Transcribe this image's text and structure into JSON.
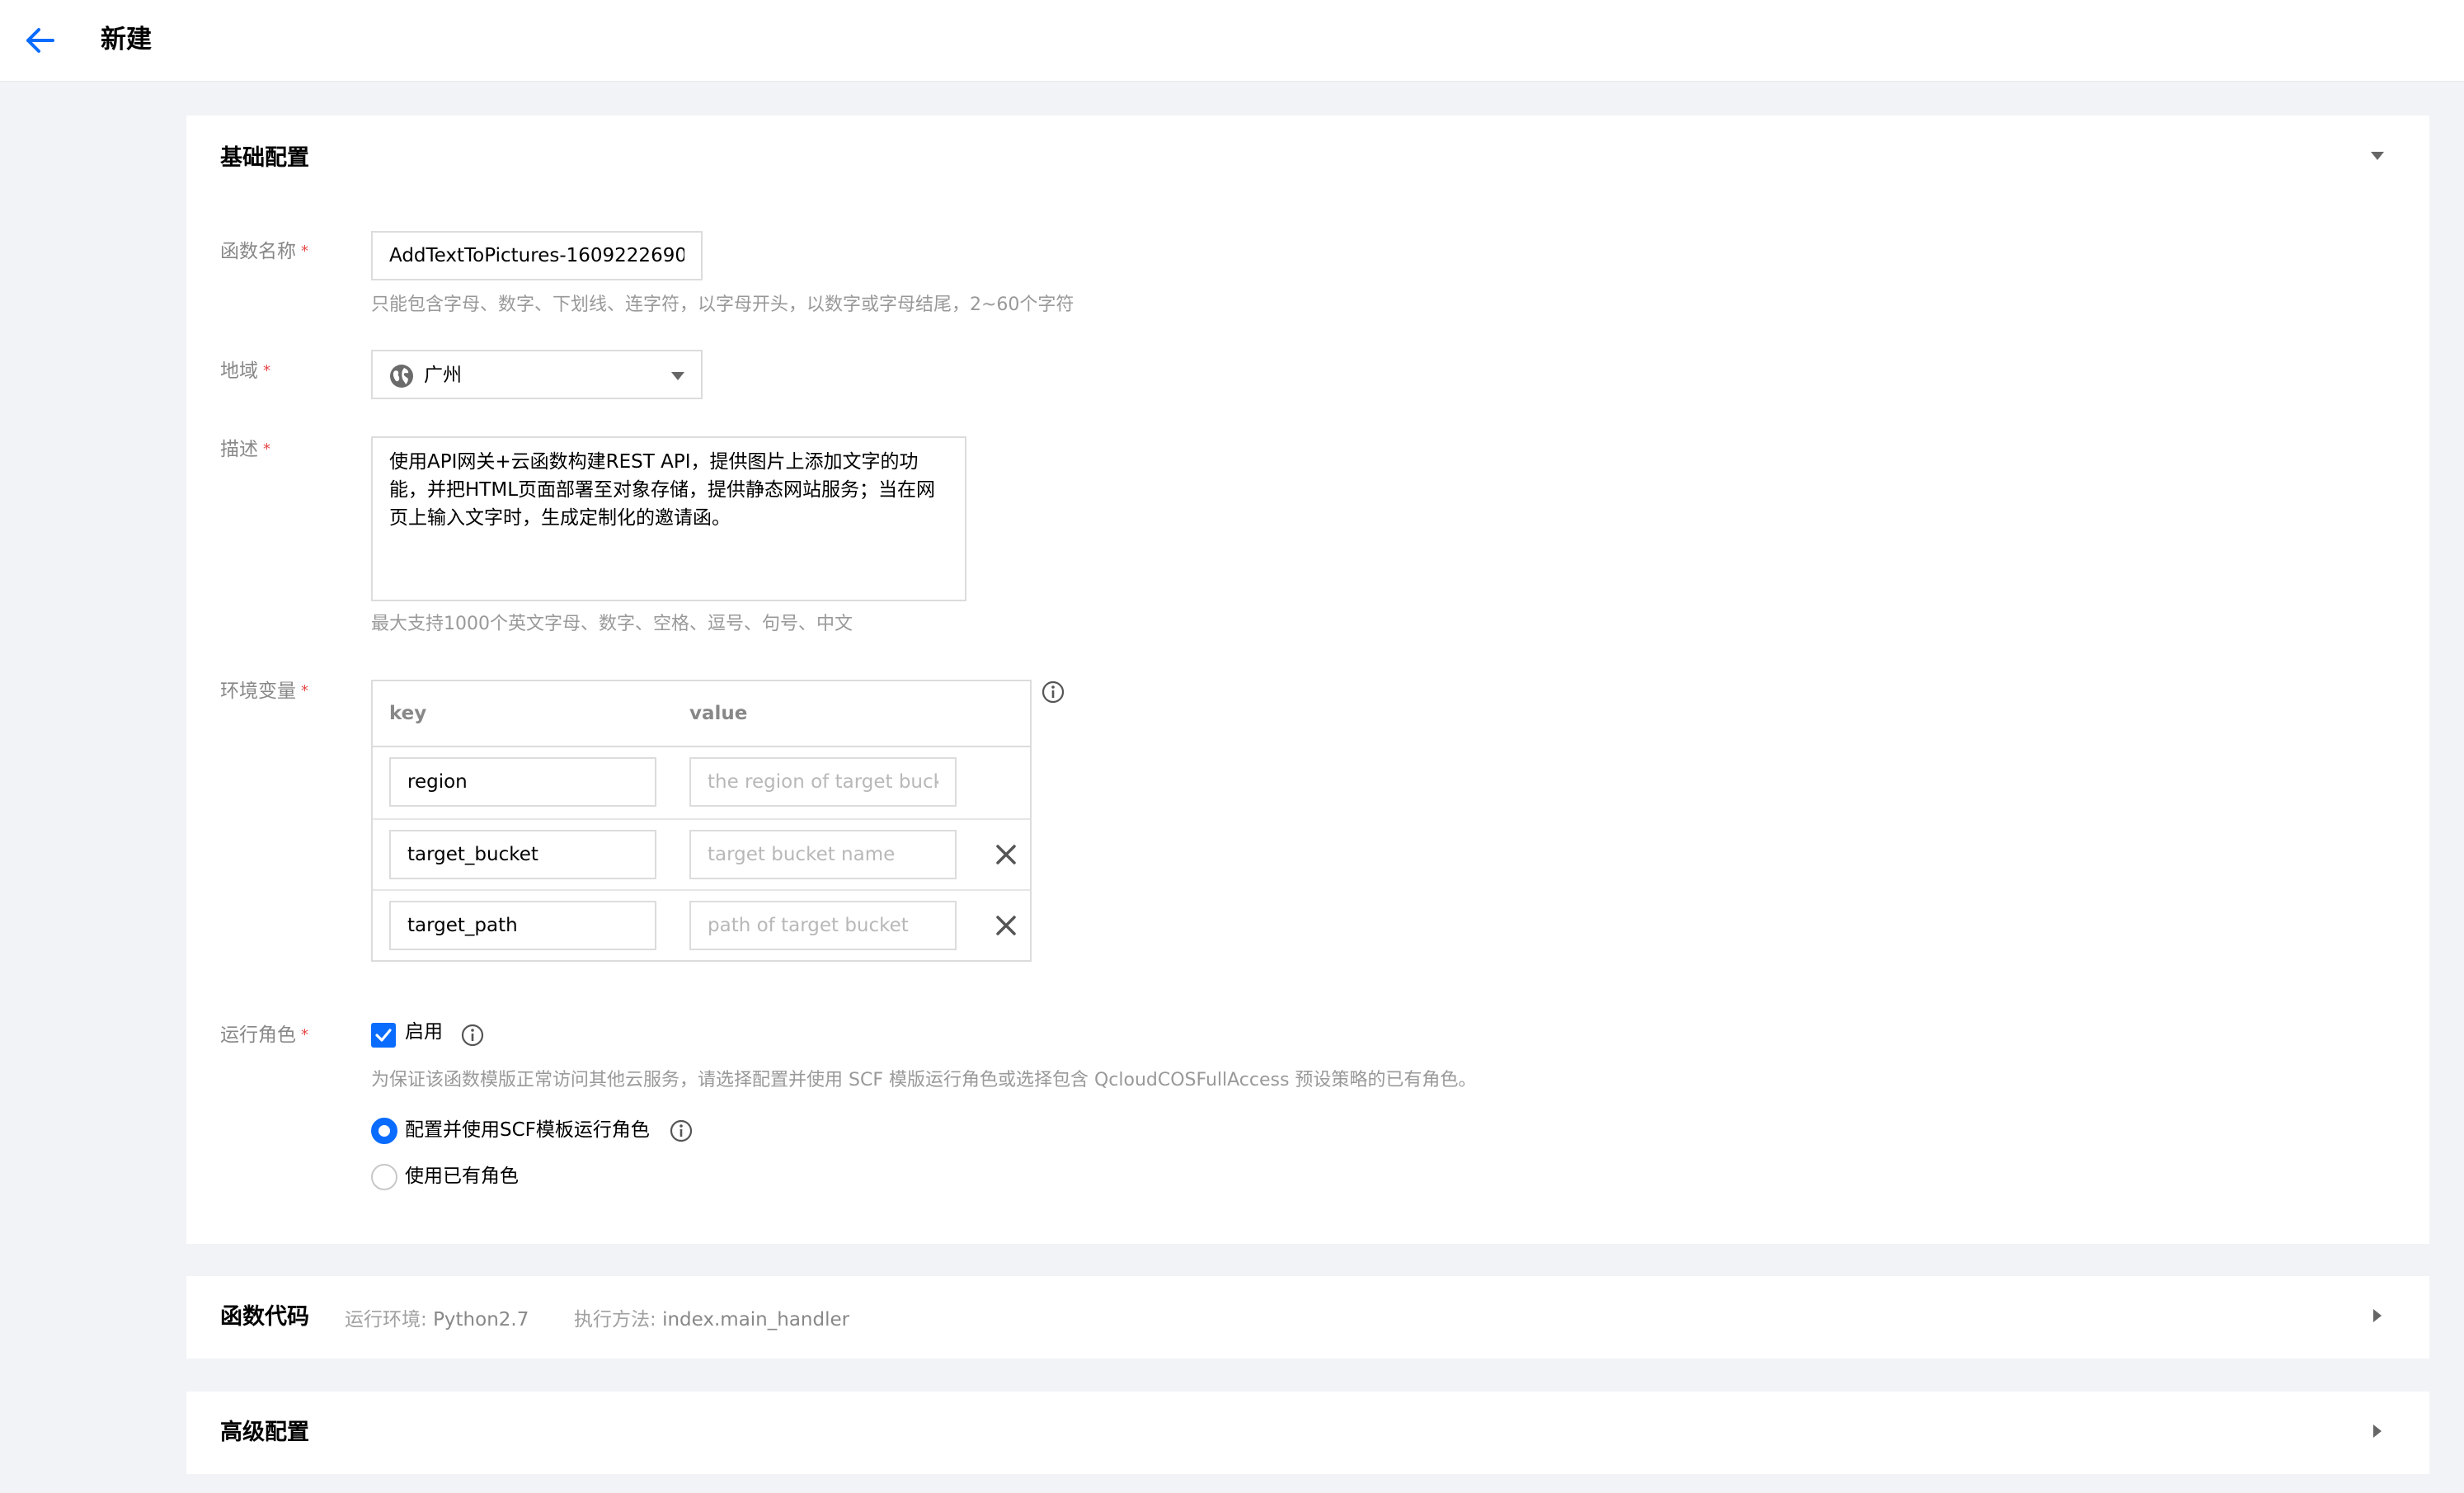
{
  "header": {
    "title": "新建",
    "back_icon": "arrow-left-icon"
  },
  "basic": {
    "title": "基础配置",
    "function_name": {
      "label": "函数名称",
      "value": "AddTextToPictures-1609222690",
      "hint": "只能包含字母、数字、下划线、连字符，以字母开头，以数字或字母结尾，2~60个字符"
    },
    "region": {
      "label": "地域",
      "value": "广州",
      "icon": "globe-icon"
    },
    "description": {
      "label": "描述",
      "value": "使用API网关+云函数构建REST API，提供图片上添加文字的功能，并把HTML页面部署至对象存储，提供静态网站服务；当在网页上输入文字时，生成定制化的邀请函。",
      "hint": "最大支持1000个英文字母、数字、空格、逗号、句号、中文"
    },
    "env": {
      "label": "环境变量",
      "col_key": "key",
      "col_value": "value",
      "rows": [
        {
          "key": "region",
          "value_placeholder": "the region of target bucket"
        },
        {
          "key": "target_bucket",
          "value_placeholder": "target bucket name"
        },
        {
          "key": "target_path",
          "value_placeholder": "path of target bucket"
        }
      ]
    },
    "role": {
      "label": "运行角色",
      "enable_label": "启用",
      "enabled": true,
      "hint": "为保证该函数模版正常访问其他云服务，请选择配置并使用 SCF 模版运行角色或选择包含 QcloudCOSFullAccess 预设策略的已有角色。",
      "options": [
        {
          "label": "配置并使用SCF模板运行角色",
          "selected": true
        },
        {
          "label": "使用已有角色",
          "selected": false
        }
      ]
    }
  },
  "code": {
    "title": "函数代码",
    "runtime_label": "运行环境:",
    "runtime_value": "Python2.7",
    "handler_label": "执行方法:",
    "handler_value": "index.main_handler"
  },
  "advanced": {
    "title": "高级配置"
  },
  "colors": {
    "accent": "#0a6cff",
    "required": "#e54545",
    "page_bg": "#f2f3f6"
  }
}
